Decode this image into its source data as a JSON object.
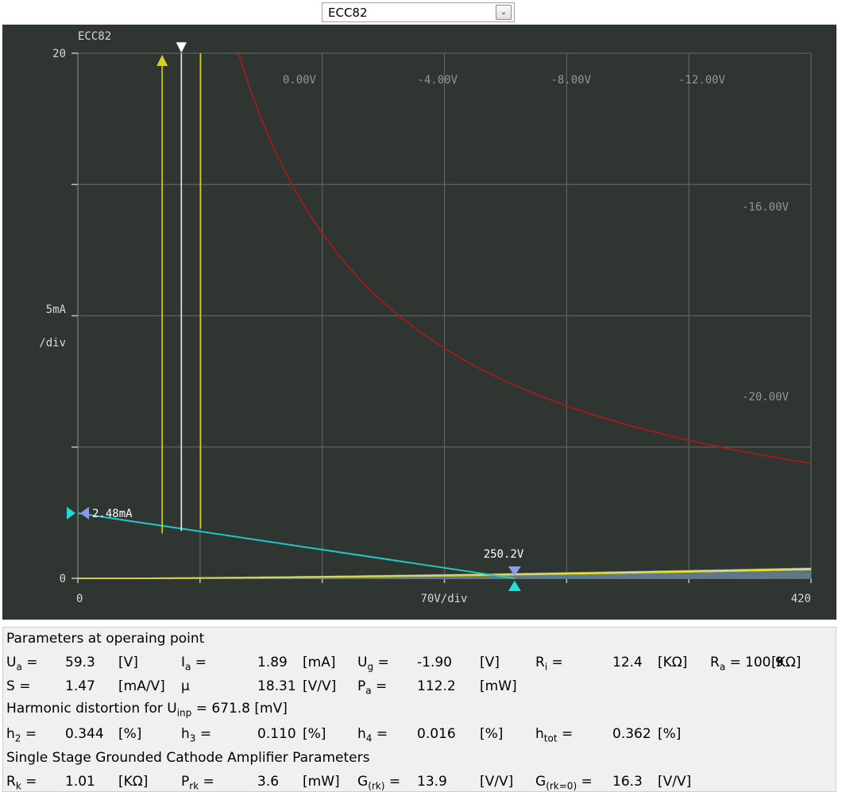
{
  "selector": {
    "value": "ECC82",
    "arrow": "chevron-down-icon"
  },
  "chart": {
    "title": "ECC82",
    "y_top_label": "20",
    "y_zero_label": "0",
    "y_unit": "5mA",
    "y_div": "/div",
    "x_zero_label": "0",
    "x_max_label": "420",
    "x_unit": "70V/div",
    "ug_labels": [
      "0.00V",
      "-4.00V",
      "-8.00V",
      "-12.00V",
      "-16.00V",
      "-20.00V"
    ],
    "ia_marker": "2.48mA",
    "ua_marker": "250.2V",
    "colors": {
      "background": "#2f3530",
      "grid": "#5f6460",
      "curve": "#5f7a88",
      "signal": "#d8d020",
      "working": "#e8e8e8",
      "load": "#20c8c8",
      "pmax": "#b01818"
    }
  },
  "chart_data": {
    "type": "line",
    "xlabel": "70V/div",
    "ylabel": "5mA /div",
    "xlim": [
      0,
      420
    ],
    "ylim": [
      0,
      20
    ],
    "grid": true,
    "operating_point": {
      "Ua": 59.3,
      "Ia": 1.89,
      "Ug": -1.9
    },
    "load_line": {
      "x": [
        0,
        250.2
      ],
      "y": [
        2.48,
        0
      ]
    },
    "series_labels": [
      "0.00V",
      "-4.00V",
      "-8.00V",
      "-12.00V",
      "-16.00V",
      "-20.00V"
    ]
  },
  "params": {
    "h1": "Parameters at operaing point",
    "row1": [
      {
        "name": "U",
        "sub": "a",
        "eq": "=",
        "value": "59.3",
        "unit": "[V]"
      },
      {
        "name": "I",
        "sub": "a",
        "eq": "=",
        "value": "1.89",
        "unit": "[mA]"
      },
      {
        "name": "U",
        "sub": "g",
        "eq": "=",
        "value": "-1.90",
        "unit": "[V]"
      },
      {
        "name": "R",
        "sub": "i",
        "eq": "=",
        "value": "12.4",
        "unit": "[KΩ]"
      },
      {
        "name": "R",
        "sub": "a",
        "eq": "=",
        "value": "100.9",
        "unit": "[KΩ]"
      }
    ],
    "row2": [
      {
        "name": "S",
        "sub": "",
        "eq": "=",
        "value": "1.47",
        "unit": "[mA/V]"
      },
      {
        "name": "μ",
        "sub": "",
        "eq": "",
        "value": "18.31",
        "unit": "[V/V]"
      },
      {
        "name": "P",
        "sub": "a",
        "eq": "=",
        "value": "112.2",
        "unit": "[mW]"
      }
    ],
    "h2_prefix": "Harmonic distortion for U",
    "h2_sub": "inp",
    "h2_value": "= 671.8 [mV]",
    "row3": [
      {
        "name": "h",
        "sub": "2",
        "eq": "=",
        "value": "0.344",
        "unit": "[%]"
      },
      {
        "name": "h",
        "sub": "3",
        "eq": "=",
        "value": "0.110",
        "unit": "[%]"
      },
      {
        "name": "h",
        "sub": "4",
        "eq": "=",
        "value": "0.016",
        "unit": "[%]"
      },
      {
        "name": "h",
        "sub": "tot",
        "eq": "=",
        "value": "0.362",
        "unit": "[%]"
      }
    ],
    "h3": "Single Stage Grounded Cathode Amplifier Parameters",
    "row4": [
      {
        "name": "R",
        "sub": "k",
        "eq": "=",
        "value": "1.01",
        "unit": "[KΩ]"
      },
      {
        "name": "P",
        "sub": "rk",
        "eq": "=",
        "value": "3.6",
        "unit": "[mW]"
      },
      {
        "name": "G",
        "sub": "(rk)",
        "eq": "=",
        "value": "13.9",
        "unit": "[V/V]"
      },
      {
        "name": "G",
        "sub": "(rk=0)",
        "eq": "=",
        "value": "16.3",
        "unit": "[V/V]"
      }
    ]
  }
}
